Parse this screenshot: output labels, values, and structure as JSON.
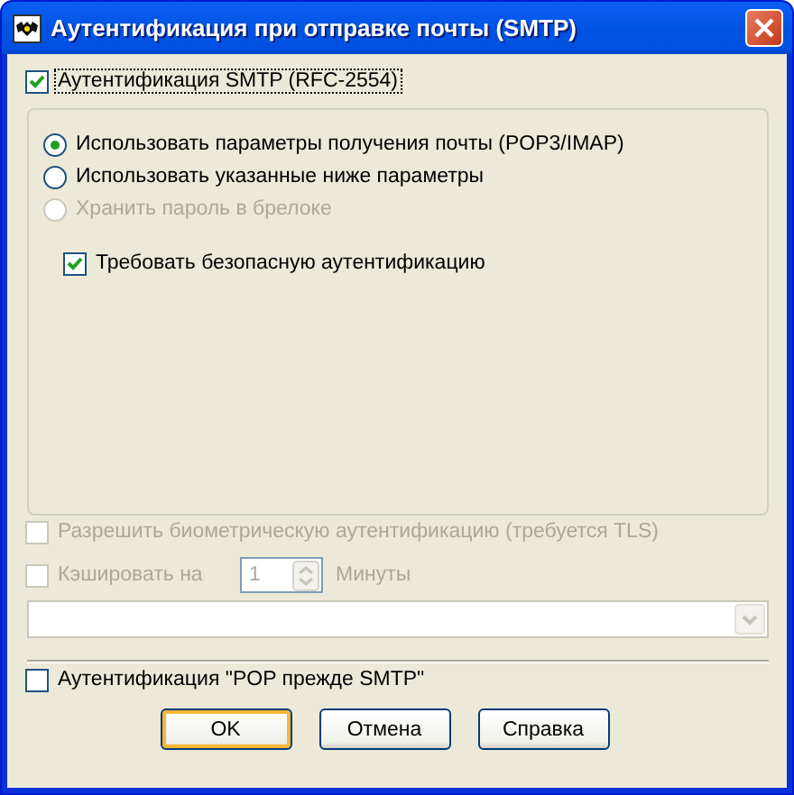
{
  "window": {
    "title": "Аутентификация при отправке почты (SMTP)"
  },
  "smtp_auth": {
    "label": "Аутентификация SMTP (RFC-2554)",
    "checked": true
  },
  "options": [
    {
      "kind": "radio",
      "label": "Использовать параметры получения почты (POP3/IMAP)",
      "selected": true,
      "disabled": false
    },
    {
      "kind": "radio",
      "label": "Использовать указанные ниже параметры",
      "selected": false,
      "disabled": false
    },
    {
      "kind": "radio",
      "label": "Хранить пароль в брелоке",
      "selected": false,
      "disabled": true
    },
    {
      "kind": "checkbox",
      "label": "Требовать безопасную аутентификацию",
      "checked": true,
      "disabled": false
    }
  ],
  "biometric": {
    "label": "Разрешить биометрическую аутентификацию (требуется TLS)",
    "checked": false,
    "disabled": true
  },
  "cache": {
    "label": "Кэшировать на",
    "checked": false,
    "disabled": true,
    "value": "1",
    "unit": "Минуты"
  },
  "combo": {
    "disabled": true
  },
  "pop_before_smtp": {
    "label": "Аутентификация \"POP прежде SMTP\"",
    "checked": false
  },
  "buttons": [
    {
      "label": "OK",
      "default": true
    },
    {
      "label": "Отмена",
      "default": false
    },
    {
      "label": "Справка",
      "default": false
    }
  ]
}
